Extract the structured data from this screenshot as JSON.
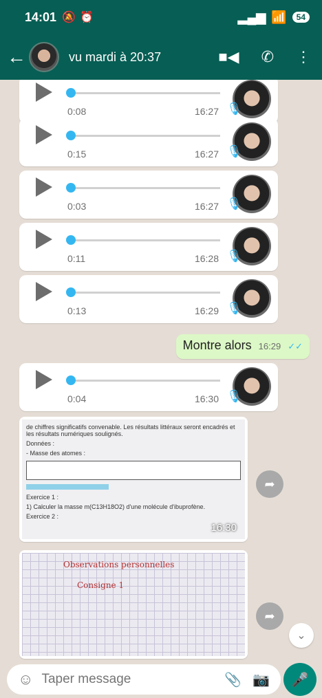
{
  "status_bar": {
    "time": "14:01",
    "battery": "54"
  },
  "header": {
    "last_seen": "vu mardi à 20:37"
  },
  "voice_messages": [
    {
      "duration": "0:08",
      "time": "16:27"
    },
    {
      "duration": "0:15",
      "time": "16:27"
    },
    {
      "duration": "0:03",
      "time": "16:27"
    },
    {
      "duration": "0:11",
      "time": "16:28"
    },
    {
      "duration": "0:13",
      "time": "16:29"
    },
    {
      "duration": "0:04",
      "time": "16:30"
    }
  ],
  "outgoing_message": {
    "text": "Montre alors",
    "time": "16:29"
  },
  "image_messages": [
    {
      "time": "16:30"
    }
  ],
  "document_text": {
    "line1": "de chiffres significatifs convenable. Les résultats littéraux seront encadrés et les résultats numériques soulignés.",
    "donnees": "Données :",
    "masse": "- Masse des atomes :",
    "exercice1": "Exercice 1 :",
    "q": "1) Calculer la masse m(C13H18O2) d'une molécule d'ibuprofène.",
    "exercice2": "Exercice 2 :"
  },
  "notebook_text": {
    "heading": "Observations personnelles",
    "line": "Consigne 1"
  },
  "input": {
    "placeholder": "Taper message"
  },
  "colors": {
    "header": "#075e54",
    "outgoing_bubble": "#dcf8c6",
    "accent": "#34b7f1",
    "send_button": "#00897b"
  }
}
